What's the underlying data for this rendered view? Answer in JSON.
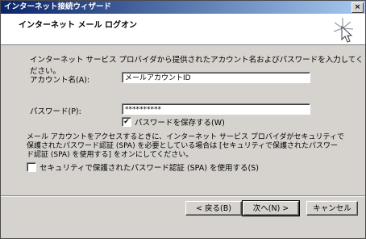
{
  "window": {
    "title": "インターネット接続ウィザード",
    "close_glyph": "×"
  },
  "header": {
    "page_title": "インターネット メール ログオン"
  },
  "content": {
    "instruction": "インターネット サービス プロバイダから提供されたアカウント名およびパスワードを入力してください。",
    "account_label": "アカウント名(A):",
    "account_value": "メールアカウントID",
    "password_label": "パスワード(P):",
    "password_value": "**********",
    "remember_password_label": "パスワードを保存する(W)",
    "remember_password_checked": true,
    "spa_paragraph": "メール アカウントをアクセスするときに、インターネット サービス プロバイダがセキュリティで保護されたパスワード認証 (SPA) を必要としている場合は [セキュリティで保護されたパスワード認証 (SPA) を使用する] をオンにしてください。",
    "spa_checkbox_label": "セキュリティで保護されたパスワード認証 (SPA) を使用する(S)",
    "spa_checked": false,
    "check_glyph": "✔"
  },
  "buttons": {
    "back": "< 戻る(B)",
    "next": "次へ(N) >",
    "cancel": "キャンセル"
  }
}
